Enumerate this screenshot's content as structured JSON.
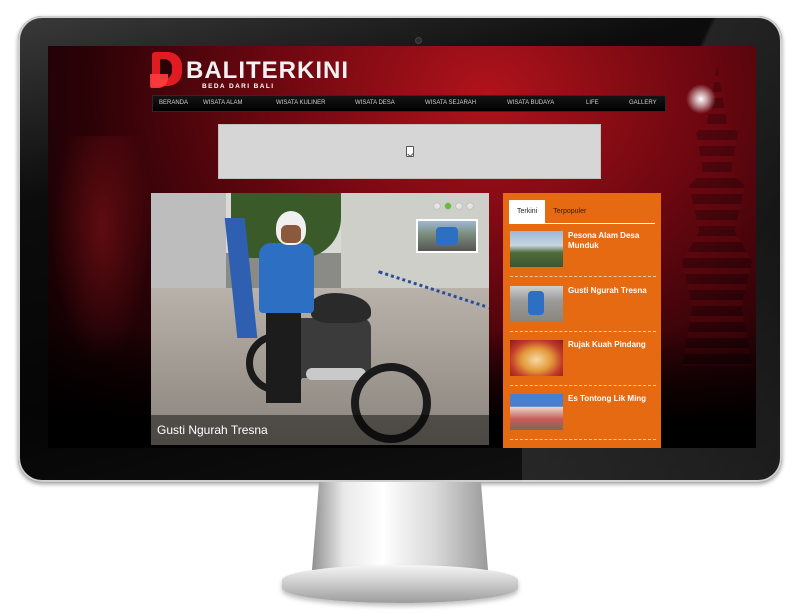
{
  "site": {
    "logo_text": "BALITERKINI",
    "tagline": "BEDA DARI BALI"
  },
  "nav": {
    "items": [
      "BERANDA",
      "WISATA ALAM",
      "WISATA KULINER",
      "WISATA DESA",
      "WISATA SEJARAH",
      "WISATA BUDAYA",
      "LIFE",
      "GALLERY"
    ]
  },
  "slider": {
    "caption": "Gusti Ngurah Tresna",
    "active_dot": 1,
    "dot_count": 4
  },
  "sidebar": {
    "tabs": [
      "Terkini",
      "Terpopuler"
    ],
    "active_tab": "Terkini",
    "items": [
      {
        "title": "Pesona Alam Desa Munduk"
      },
      {
        "title": "Gusti Ngurah Tresna"
      },
      {
        "title": "Rujak Kuah Pindang"
      },
      {
        "title": "Es Tontong Lik Ming"
      }
    ]
  },
  "colors": {
    "accent_orange": "#e56a12",
    "brand_red": "#e01b22",
    "nav_bg": "#000000",
    "active_dot": "#5fbf3a"
  },
  "icons": {
    "banner": "broken-image-icon"
  }
}
